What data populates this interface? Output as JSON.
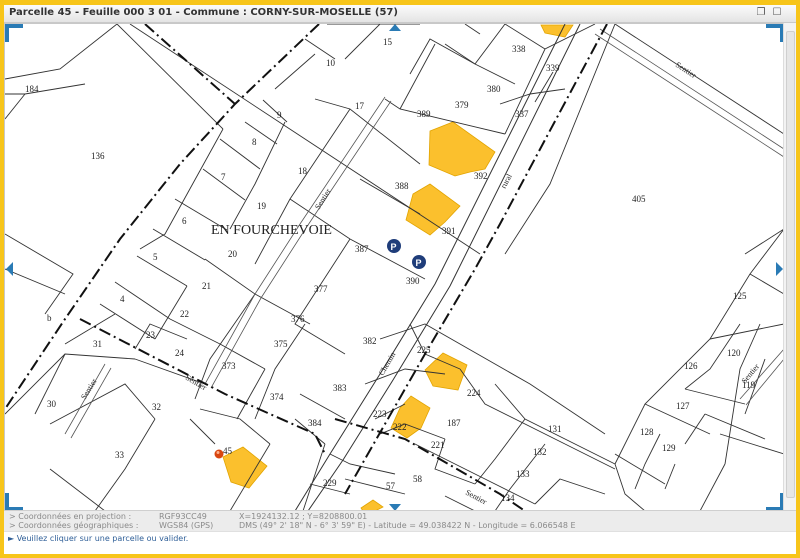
{
  "window": {
    "title": "Parcelle 45 - Feuille 000 3 01 - Commune : CORNY-SUR-MOSELLE (57)",
    "buttons": [
      "restore-icon",
      "close-icon"
    ]
  },
  "map": {
    "locality": "EN FOURCHEVOIE",
    "parking_symbol": "P",
    "street_labels": [
      "Sentier",
      "Sentier",
      "Sentier",
      "Sentier",
      "Sentier",
      "Sentier",
      "Chemin",
      "rural"
    ],
    "parcels": [
      {
        "num": "15"
      },
      {
        "num": "10"
      },
      {
        "num": "17"
      },
      {
        "num": "9"
      },
      {
        "num": "8"
      },
      {
        "num": "18"
      },
      {
        "num": "7"
      },
      {
        "num": "19"
      },
      {
        "num": "6"
      },
      {
        "num": "20"
      },
      {
        "num": "5"
      },
      {
        "num": "21"
      },
      {
        "num": "4"
      },
      {
        "num": "22"
      },
      {
        "num": "23"
      },
      {
        "num": "24"
      },
      {
        "num": "31"
      },
      {
        "num": "30"
      },
      {
        "num": "32"
      },
      {
        "num": "33"
      },
      {
        "num": "45"
      },
      {
        "num": "373"
      },
      {
        "num": "374"
      },
      {
        "num": "375"
      },
      {
        "num": "376"
      },
      {
        "num": "377"
      },
      {
        "num": "387"
      },
      {
        "num": "388"
      },
      {
        "num": "389"
      },
      {
        "num": "379"
      },
      {
        "num": "380"
      },
      {
        "num": "338"
      },
      {
        "num": "339"
      },
      {
        "num": "337"
      },
      {
        "num": "392"
      },
      {
        "num": "391"
      },
      {
        "num": "390"
      },
      {
        "num": "382"
      },
      {
        "num": "383"
      },
      {
        "num": "384"
      },
      {
        "num": "225"
      },
      {
        "num": "224"
      },
      {
        "num": "223"
      },
      {
        "num": "222"
      },
      {
        "num": "187"
      },
      {
        "num": "221"
      },
      {
        "num": "131"
      },
      {
        "num": "132"
      },
      {
        "num": "133"
      },
      {
        "num": "134"
      },
      {
        "num": "57"
      },
      {
        "num": "58"
      },
      {
        "num": "229"
      },
      {
        "num": "405"
      },
      {
        "num": "125"
      },
      {
        "num": "126"
      },
      {
        "num": "120"
      },
      {
        "num": "119"
      },
      {
        "num": "127"
      },
      {
        "num": "128"
      },
      {
        "num": "129"
      },
      {
        "num": "136"
      },
      {
        "num": "184"
      },
      {
        "num": "b"
      }
    ]
  },
  "info": {
    "projection_label": "> Coordonnées en projection :",
    "projection_system": "RGF93CC49",
    "projection_coords": "X=1924132.12 ; Y=8208800.01",
    "geo_label": "> Coordonnées géographiques :",
    "geo_system": "WGS84 (GPS)",
    "geo_coords": "DMS (49° 2' 18\" N - 6° 3' 59\" E) - Latitude = 49.038422 N - Longitude = 6.066548 E"
  },
  "status": {
    "message": "► Veuillez cliquer sur une parcelle ou valider."
  },
  "colors": {
    "frame": "#f7c51a",
    "building": "#fbc02d",
    "accent": "#2a7bb5",
    "parking": "#1f3d7a"
  }
}
